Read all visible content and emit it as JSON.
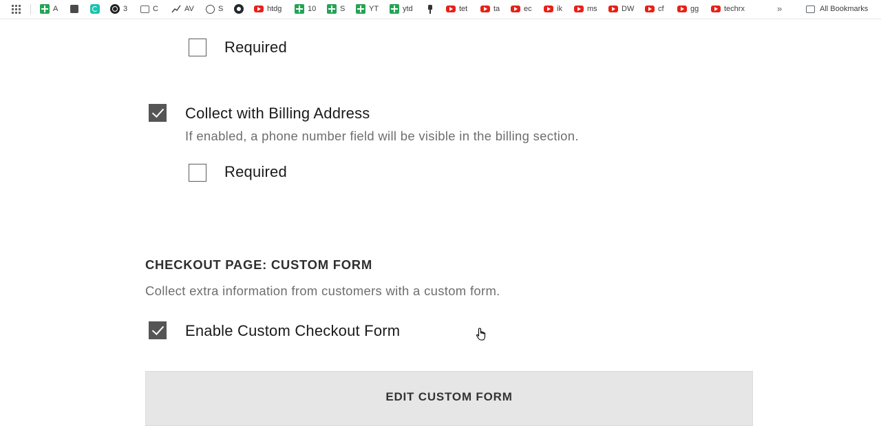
{
  "bookmarks": {
    "items": [
      {
        "label": "A",
        "icon": "sheets-icon"
      },
      {
        "label": "",
        "icon": "puzzle-icon"
      },
      {
        "label": "",
        "icon": "teal-app-icon"
      },
      {
        "label": "3",
        "icon": "threads-icon"
      },
      {
        "label": "C",
        "icon": "folder-icon"
      },
      {
        "label": "AV",
        "icon": "trend-icon"
      },
      {
        "label": "S",
        "icon": "globe-icon"
      },
      {
        "label": "",
        "icon": "github-icon"
      },
      {
        "label": "htdg",
        "icon": "youtube-icon"
      },
      {
        "label": "10",
        "icon": "sheets-icon"
      },
      {
        "label": "S",
        "icon": "sheets-icon"
      },
      {
        "label": "YT",
        "icon": "sheets-icon"
      },
      {
        "label": "ytd",
        "icon": "sheets-icon"
      },
      {
        "label": "",
        "icon": "pin-icon"
      },
      {
        "label": "tet",
        "icon": "youtube-icon"
      },
      {
        "label": "ta",
        "icon": "youtube-icon"
      },
      {
        "label": "ec",
        "icon": "youtube-icon"
      },
      {
        "label": "ik",
        "icon": "youtube-icon"
      },
      {
        "label": "ms",
        "icon": "youtube-icon"
      },
      {
        "label": "DW",
        "icon": "youtube-icon"
      },
      {
        "label": "cf",
        "icon": "youtube-icon"
      },
      {
        "label": "gg",
        "icon": "youtube-icon"
      },
      {
        "label": "techrx",
        "icon": "youtube-icon"
      }
    ],
    "more": "»",
    "all_bookmarks": "All Bookmarks"
  },
  "phone": {
    "required_top": {
      "label": "Required",
      "checked": false
    },
    "collect_billing": {
      "label": "Collect with Billing Address",
      "checked": true
    },
    "collect_billing_desc": "If enabled, a phone number field will be visible in the billing section.",
    "required_billing": {
      "label": "Required",
      "checked": false
    }
  },
  "custom_form": {
    "heading": "CHECKOUT PAGE: CUSTOM FORM",
    "description": "Collect extra information from customers with a custom form.",
    "enable": {
      "label": "Enable Custom Checkout Form",
      "checked": true
    },
    "edit_button": "EDIT CUSTOM FORM"
  },
  "colors": {
    "checkbox_checked": "#555555",
    "button_bg": "#e6e6e6",
    "desc_text": "#6e6e6e"
  }
}
